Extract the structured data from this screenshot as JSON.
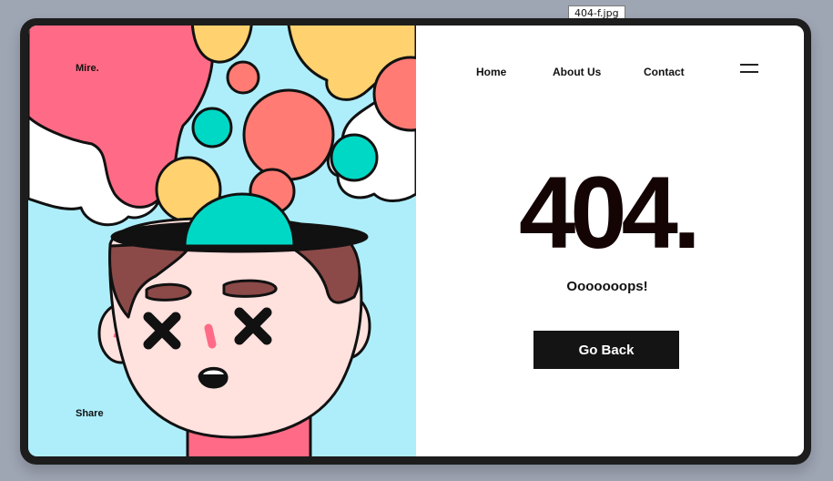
{
  "file_label": "404-f.jpg",
  "brand": "Mire.",
  "share_label": "Share",
  "nav": {
    "items": [
      "Home",
      "About Us",
      "Contact"
    ]
  },
  "menu_icon": "hamburger-menu-icon",
  "error": {
    "code": "404.",
    "message": "Ooooooops!",
    "button_label": "Go Back"
  },
  "colors": {
    "background": "#9ea5b3",
    "frame": "#1d1d1d",
    "illustration_bg": "#aeeefb",
    "pink": "#ff6b86",
    "coral": "#ff7b73",
    "yellow": "#ffd16f",
    "teal": "#00d8c6",
    "hair": "#8b4a48",
    "skin": "#ffe1de",
    "button": "#141414"
  }
}
